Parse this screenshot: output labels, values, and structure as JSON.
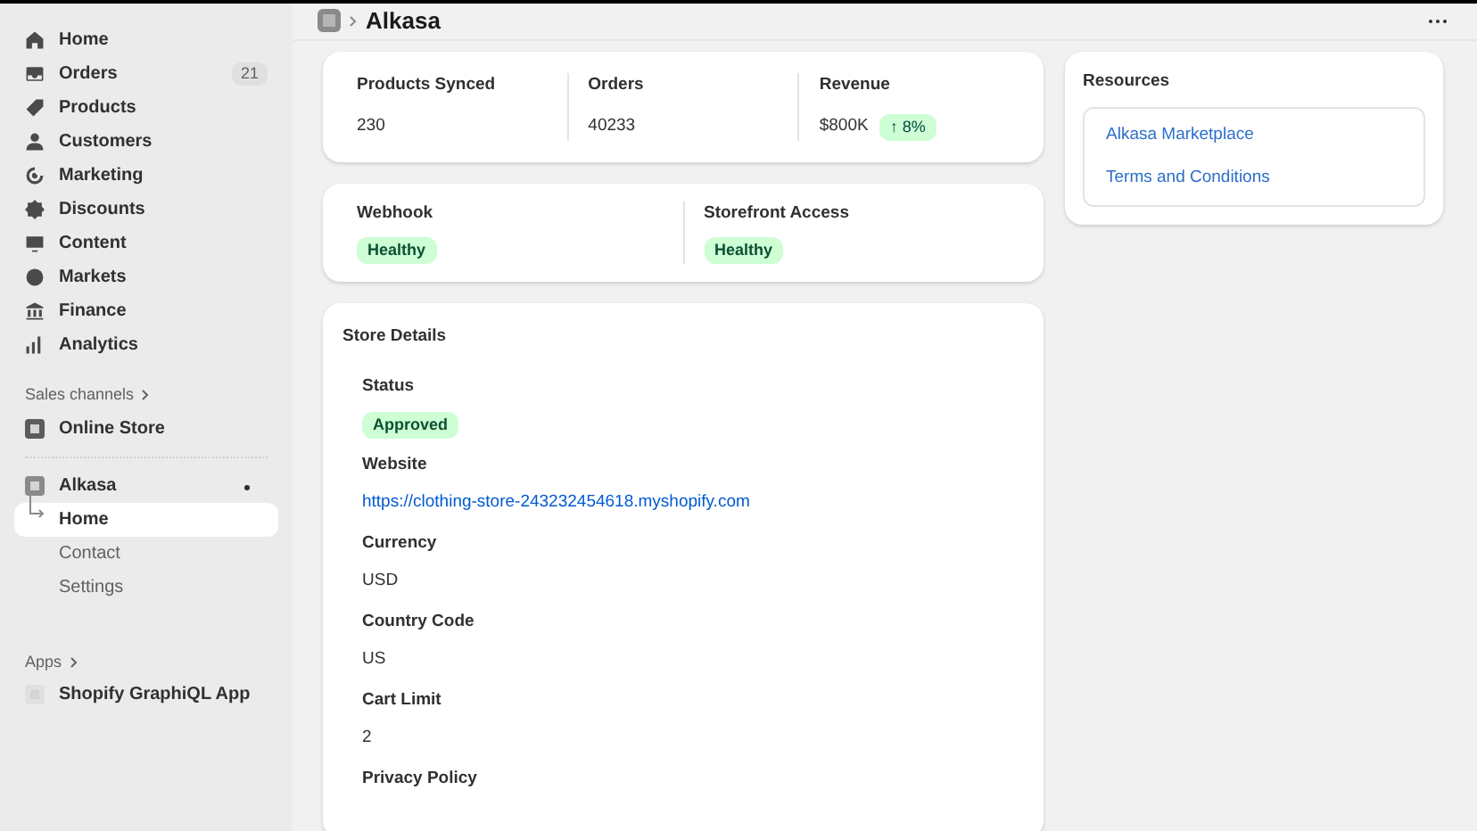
{
  "sidebar": {
    "items": [
      {
        "label": "Home",
        "selected": false
      },
      {
        "label": "Orders",
        "selected": false,
        "count": "21"
      },
      {
        "label": "Products",
        "selected": false
      },
      {
        "label": "Customers",
        "selected": false
      },
      {
        "label": "Marketing",
        "selected": false
      },
      {
        "label": "Discounts",
        "selected": false
      },
      {
        "label": "Content",
        "selected": false
      },
      {
        "label": "Markets",
        "selected": false
      },
      {
        "label": "Finance",
        "selected": false
      },
      {
        "label": "Analytics",
        "selected": false
      }
    ],
    "sales_channels": {
      "heading": "Sales channels",
      "items": [
        {
          "label": "Online Store",
          "selected": false
        }
      ]
    },
    "app": {
      "label": "Alkasa",
      "children": [
        {
          "label": "Home",
          "selected": true
        },
        {
          "label": "Contact",
          "selected": false
        },
        {
          "label": "Settings",
          "selected": false
        }
      ]
    },
    "apps": {
      "heading": "Apps",
      "items": [
        {
          "label": "Shopify GraphiQL App",
          "selected": false
        }
      ]
    }
  },
  "header": {
    "title": "Alkasa"
  },
  "stats": [
    {
      "label": "Products Synced",
      "value": "230"
    },
    {
      "label": "Orders",
      "value": "40233"
    },
    {
      "label": "Revenue",
      "value": "$800K",
      "trend": "↑ 8%"
    }
  ],
  "health": [
    {
      "label": "Webhook",
      "status": "Healthy"
    },
    {
      "label": "Storefront Access",
      "status": "Healthy"
    }
  ],
  "store_details": {
    "title": "Store Details",
    "fields": [
      {
        "label": "Status",
        "kind": "badge",
        "value": "Approved"
      },
      {
        "label": "Website",
        "kind": "link",
        "value": "https://clothing-store-243232454618.myshopify.com"
      },
      {
        "label": "Currency",
        "kind": "text",
        "value": "USD"
      },
      {
        "label": "Country Code",
        "kind": "text",
        "value": "US"
      },
      {
        "label": "Cart Limit",
        "kind": "text",
        "value": "2"
      },
      {
        "label": "Privacy Policy",
        "kind": "none"
      }
    ]
  },
  "resources": {
    "title": "Resources",
    "links": [
      "Alkasa Marketplace",
      "Terms and Conditions"
    ]
  }
}
